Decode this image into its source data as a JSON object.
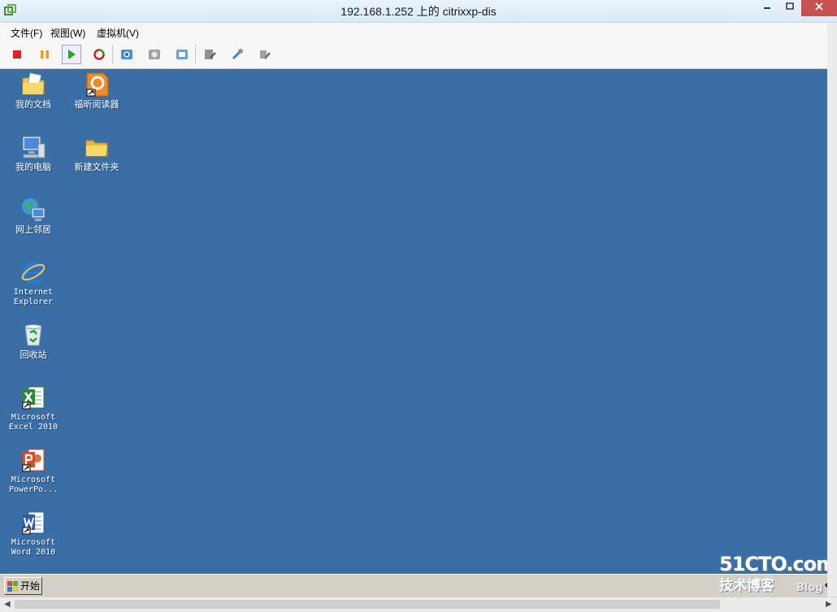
{
  "window": {
    "title": "192.168.1.252 上的 citrixxp-dis"
  },
  "menu": [
    "文件(F)",
    "视图(W)",
    "虚拟机(V)"
  ],
  "toolbar_buttons": [
    "stop-icon",
    "pause-icon",
    "play-icon",
    "refresh-icon",
    "snapshot-icon",
    "revert-icon",
    "manage-snapshots-icon",
    "settings-icon",
    "tools-icon",
    "wrench-icon"
  ],
  "desktop_icons": [
    {
      "label": "我的文档",
      "icon": "my-documents-icon"
    },
    {
      "label": "福昕阅读器",
      "icon": "foxit-reader-icon"
    },
    {
      "label": "我的电脑",
      "icon": "my-computer-icon"
    },
    {
      "label": "新建文件夹",
      "icon": "folder-icon"
    },
    {
      "label": "网上邻居",
      "icon": "network-icon"
    },
    {
      "label": "Internet Explorer",
      "icon": "ie-icon"
    },
    {
      "label": "回收站",
      "icon": "recycle-bin-icon"
    },
    {
      "label": "Microsoft Excel 2010",
      "icon": "excel-icon"
    },
    {
      "label": "Microsoft PowerPo...",
      "icon": "powerpoint-icon"
    },
    {
      "label": "Microsoft Word 2010",
      "icon": "word-icon"
    }
  ],
  "taskbar": {
    "start_label": "开始"
  },
  "watermark": {
    "line1": "51CTO.com",
    "line2": "技术博客",
    "line3": "Blog"
  },
  "colors": {
    "desktop": "#3a6ea5",
    "titlebar": "#dcebf8",
    "close_button": "#c75050"
  }
}
